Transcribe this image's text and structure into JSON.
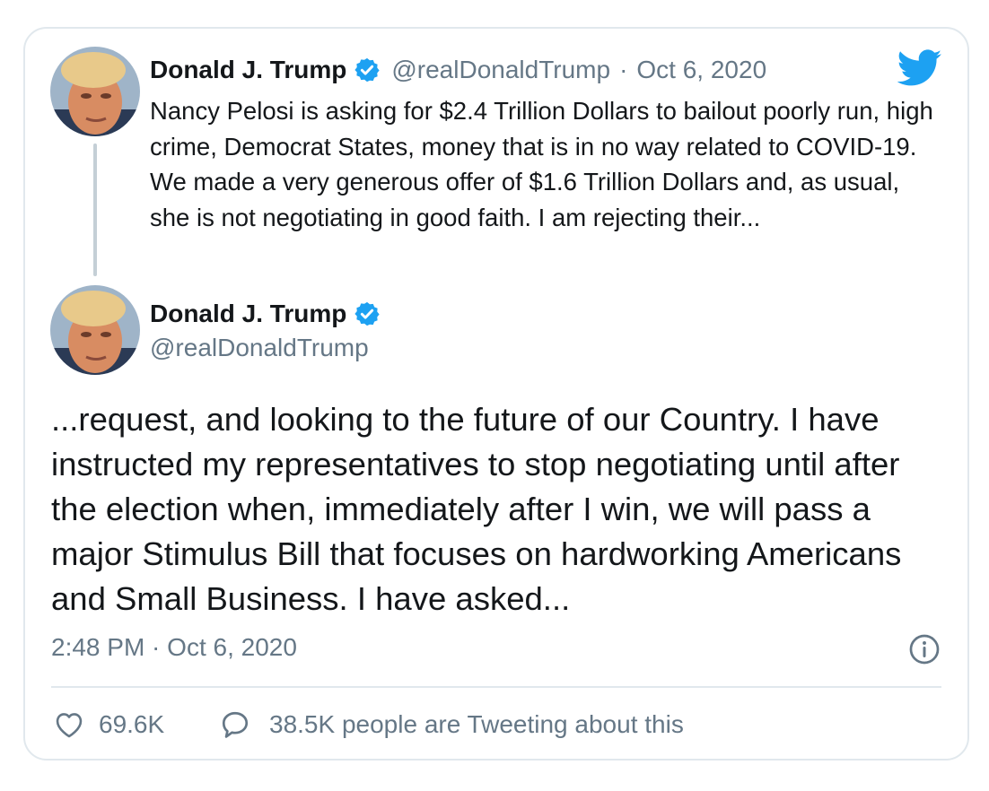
{
  "quoted_tweet": {
    "display_name": "Donald J. Trump",
    "handle": "@realDonaldTrump",
    "separator": "·",
    "date": "Oct 6, 2020",
    "text": "Nancy Pelosi is asking for $2.4 Trillion Dollars to bailout poorly run, high crime, Democrat States, money that is in no way related to COVID-19. We made a very generous offer of $1.6 Trillion Dollars and, as usual, she is not negotiating in good faith. I am rejecting their..."
  },
  "main_tweet": {
    "display_name": "Donald J. Trump",
    "handle": "@realDonaldTrump",
    "text": "...request, and looking to the future of our Country. I have instructed my representatives to stop negotiating until after the election when, immediately after I win, we will pass a major Stimulus Bill that focuses on hardworking Americans and Small Business. I have asked...",
    "timestamp": "2:48 PM · Oct 6, 2020",
    "like_count": "69.6K",
    "reply_text": "38.5K people are Tweeting about this"
  },
  "icons": {
    "verified": "verified-badge-icon",
    "bird": "twitter-bird-icon",
    "info": "info-icon",
    "like": "heart-icon",
    "reply": "speech-bubble-icon"
  },
  "colors": {
    "brand_blue": "#1da1f2",
    "text": "#14171a",
    "secondary_text": "#657786",
    "border": "#e1e8ed",
    "thread_line": "#c4cfd6"
  }
}
